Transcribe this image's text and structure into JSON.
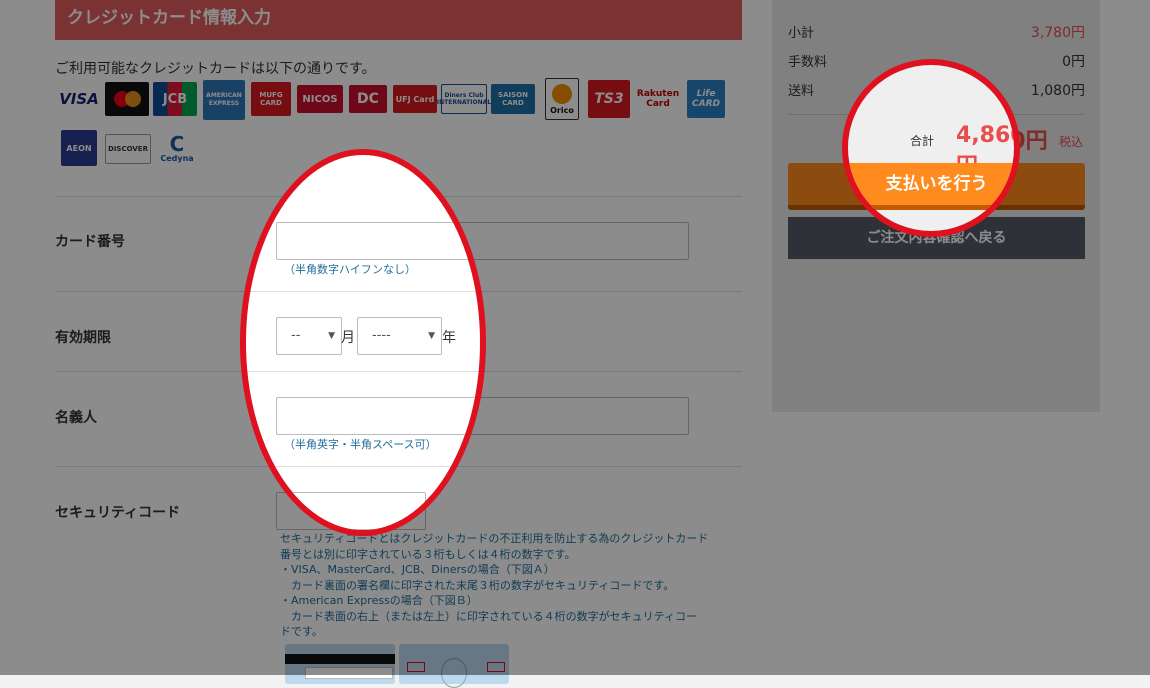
{
  "section": {
    "title": "クレジットカード情報入力"
  },
  "intro": "ご利用可能なクレジットカードは以下の通りです。",
  "logos": [
    "VISA",
    "mastercard",
    "JCB",
    "AMERICAN EXPRESS",
    "MUFG CARD",
    "NICOS",
    "DC",
    "UFJ Card",
    "Diners Club INTERNATIONAL",
    "SAISON CARD",
    "Orico",
    "TS3",
    "Rakuten Card",
    "Life CARD",
    "AEON",
    "DISCOVER",
    "Cedyna"
  ],
  "form": {
    "card_number": {
      "label": "カード番号",
      "hint": "（半角数字ハイフンなし）",
      "value": ""
    },
    "expiry": {
      "label": "有効期限",
      "month": "--",
      "month_unit": "月",
      "year": "----",
      "year_unit": "年"
    },
    "holder": {
      "label": "名義人",
      "hint": "（半角英字・半角スペース可）",
      "value": ""
    },
    "cvc": {
      "label": "セキュリティコード",
      "help_lines": [
        "セキュリティコードとはクレジットカードの不正利用を防止する為のクレジットカード",
        "番号とは別に印字されている３桁もしくは４桁の数字です。",
        "・VISA、MasterCard、JCB、Dinersの場合（下図Ａ）",
        "　カード裏面の署名欄に印字された末尾３桁の数字がセキュリティコードです。",
        "・American Expressの場合（下図Ｂ）",
        "　カード表面の右上（または左上）に印字されている４桁の数字がセキュリティコー",
        "ドです。"
      ]
    }
  },
  "summary": {
    "subtotal_label": "小計",
    "subtotal_value": "3,780円",
    "fee_label": "手数料",
    "fee_value": "0円",
    "shipping_label": "送料",
    "shipping_value": "1,080円",
    "total_label": "合計",
    "total_value": "4,860円",
    "total_tax": "税込",
    "pay_button": "支払いを行う",
    "back_button": "ご注文内容確認へ戻る"
  },
  "colors": {
    "header": "#e05b5b",
    "pay": "#ff8a1d",
    "back": "#555b66",
    "highlight": "#e0101e",
    "price": "#e94d4d"
  }
}
